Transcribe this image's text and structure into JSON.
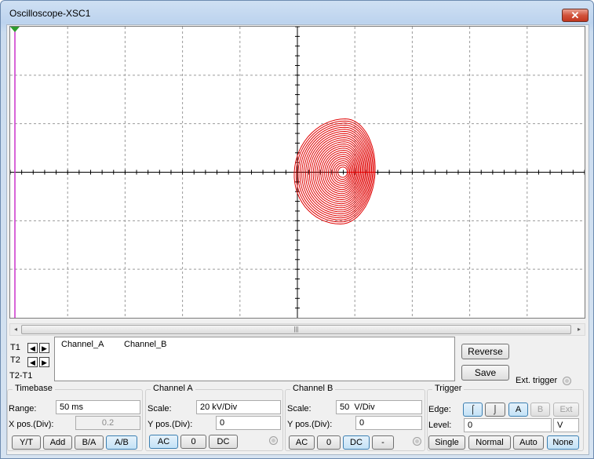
{
  "window": {
    "title": "Oscilloscope-XSC1",
    "close_glyph": "✕"
  },
  "display": {
    "trace_color": "#e00000",
    "cursor_color": "#cc33cc",
    "grid_color": "#9a9a9a",
    "axis_color": "#000000",
    "cursor_marker": "8",
    "mode": "B/A"
  },
  "scrollbar": {
    "left_arrow": "◂",
    "right_arrow": "▸",
    "grip": "|||"
  },
  "cursors": {
    "t1": "T1",
    "t2": "T2",
    "t2t1": "T2-T1",
    "left_arrow": "◀",
    "right_arrow": "▶"
  },
  "readout": {
    "col1": "Channel_A",
    "col2": "Channel_B"
  },
  "buttons": {
    "reverse": "Reverse",
    "save": "Save"
  },
  "ext_trigger": {
    "label": "Ext. trigger"
  },
  "timebase": {
    "title": "Timebase",
    "range_label": "Range:",
    "range_value": "50 ms",
    "xpos_label": "X pos.(Div):",
    "xpos_value": "0.2",
    "modes": [
      "Y/T",
      "Add",
      "B/A",
      "A/B"
    ],
    "active_mode": "A/B"
  },
  "channel_a": {
    "title": "Channel A",
    "scale_label": "Scale:",
    "scale_value": "20 kV/Div",
    "ypos_label": "Y pos.(Div):",
    "ypos_value": "0",
    "coupling": [
      "AC",
      "0",
      "DC"
    ],
    "active_coupling": "AC"
  },
  "channel_b": {
    "title": "Channel B",
    "scale_label": "Scale:",
    "scale_value": "50  V/Div",
    "ypos_label": "Y pos.(Div):",
    "ypos_value": "0",
    "coupling": [
      "AC",
      "0",
      "DC",
      "-"
    ],
    "active_coupling": "DC"
  },
  "trigger": {
    "title": "Trigger",
    "edge_label": "Edge:",
    "edge_rising": "⌠",
    "edge_falling": "⌡",
    "sources": [
      "A",
      "B",
      "Ext"
    ],
    "active_source": "A",
    "level_label": "Level:",
    "level_value": "0",
    "level_unit": "V",
    "modes": [
      "Single",
      "Normal",
      "Auto",
      "None"
    ],
    "active_mode": "None"
  }
}
